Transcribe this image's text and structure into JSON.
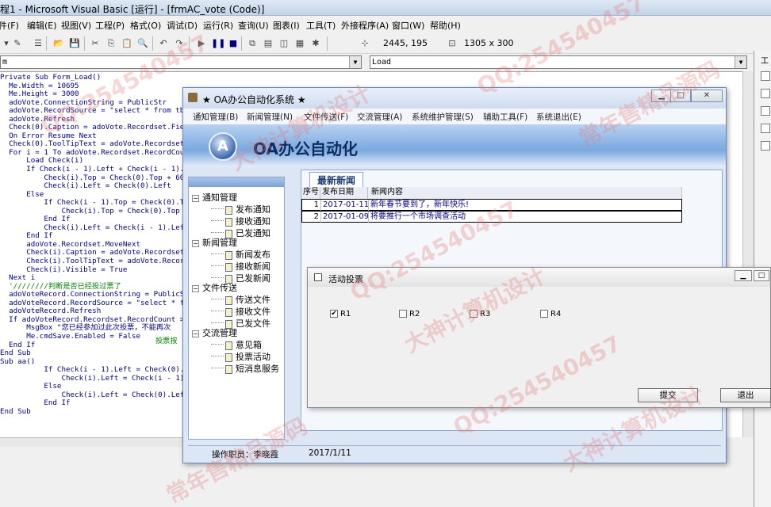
{
  "vb": {
    "title": "程1 - Microsoft Visual Basic [运行] - [frmAC_vote (Code)]",
    "menu": [
      "件(F)",
      "编辑(E)",
      "视图(V)",
      "工程(P)",
      "格式(O)",
      "调试(D)",
      "运行(R)",
      "查询(U)",
      "图表(I)",
      "工具(T)",
      "外接程序(A)",
      "窗口(W)",
      "帮助(H)"
    ],
    "toolbar": {
      "position": "2445, 195",
      "size": "1305 x 300"
    },
    "object_combo": "m",
    "proc_combo": "Load",
    "right_panel_label": "工",
    "code": [
      {
        "t": "Private Sub Form_Load()",
        "c": "k"
      },
      {
        "t": "  Me.Width = 10695",
        "c": "k"
      },
      {
        "t": "  Me.Height = 3000",
        "c": "k"
      },
      {
        "t": "  adoVote.ConnectionString = PublicStr",
        "c": "k"
      },
      {
        "t": "  adoVote.RecordSource = \"select * from tbO",
        "c": "k"
      },
      {
        "t": "  adoVote.Refresh",
        "c": "k"
      },
      {
        "t": "  Check(0).Caption = adoVote.Recordset.Fiel",
        "c": "k"
      },
      {
        "t": "  On Error Resume Next",
        "c": "k"
      },
      {
        "t": "  Check(0).ToolTipText = adoVote.Recordset.F",
        "c": "k"
      },
      {
        "t": "  For i = 1 To adoVote.Recordset.RecordCoun",
        "c": "k"
      },
      {
        "t": "      Load Check(i)",
        "c": "k"
      },
      {
        "t": "      If Check(i - 1).Left + Check(i - 1).W",
        "c": "k"
      },
      {
        "t": "          Check(i).Top = Check(0).Top + 600",
        "c": "k"
      },
      {
        "t": "          Check(i).Left = Check(0).Left",
        "c": "k"
      },
      {
        "t": "      Else",
        "c": "k"
      },
      {
        "t": "          If Check(i - 1).Top = Check(0).Top",
        "c": "k"
      },
      {
        "t": "              Check(i).Top = Check(0).Top + 60",
        "c": "k"
      },
      {
        "t": "          End If",
        "c": "k"
      },
      {
        "t": "          Check(i).Left = Check(i - 1).Left +",
        "c": "k"
      },
      {
        "t": "      End If",
        "c": "k"
      },
      {
        "t": "      adoVote.Recordset.MoveNext",
        "c": "k"
      },
      {
        "t": "      Check(i).Caption = adoVote.Recordset.",
        "c": "k"
      },
      {
        "t": "      Check(i).ToolTipText = adoVote.Record",
        "c": "k"
      },
      {
        "t": "      Check(i).Visible = True",
        "c": "k"
      },
      {
        "t": "  Next i",
        "c": "k"
      },
      {
        "t": "  '////////判断是否已经投过票了",
        "c": "g"
      },
      {
        "t": "  adoVoteRecord.ConnectionString = PublicSt",
        "c": "k"
      },
      {
        "t": "  adoVoteRecord.RecordSource = \"select * fr",
        "c": "k"
      },
      {
        "t": "  adoVoteRecord.Refresh",
        "c": "k"
      },
      {
        "t": "  If adoVoteRecord.Recordset.RecordCount > 0",
        "c": "k"
      },
      {
        "t": "      MsgBox \"您已经参加过此次投票，不能再次",
        "c": "k"
      },
      {
        "t": "      Me.cmdSave.Enabled = False",
        "c": "k"
      },
      {
        "t": "  End If",
        "c": "k"
      },
      {
        "t": "End Sub",
        "c": "k"
      },
      {
        "t": "Sub aa()",
        "c": "k"
      },
      {
        "t": "          If Check(i - 1).Left = Check(0).Le",
        "c": "k"
      },
      {
        "t": "              Check(i).Left = Check(i - 1).Le",
        "c": "k"
      },
      {
        "t": "          Else",
        "c": "k"
      },
      {
        "t": "              Check(i).Left = Check(0).Left",
        "c": "k"
      },
      {
        "t": "          End If",
        "c": "k"
      },
      {
        "t": "End Sub",
        "c": "k"
      }
    ],
    "code_tail_green": "投票按"
  },
  "oa": {
    "title": "★ OA办公自动化系统 ★",
    "menu": [
      "通知管理(B)",
      "新闻管理(N)",
      "文件传送(F)",
      "交流管理(A)",
      "系统维护管理(S)",
      "辅助工具(F)",
      "系统退出(E)"
    ],
    "logo_letter": "A",
    "brand": "OA办公自动化",
    "tree": [
      {
        "group": "通知管理",
        "items": [
          "发布通知",
          "接收通知",
          "已发通知"
        ]
      },
      {
        "group": "新闻管理",
        "items": [
          "新闻发布",
          "接收新闻",
          "已发新闻"
        ]
      },
      {
        "group": "文件传送",
        "items": [
          "传送文件",
          "接收文件",
          "已发文件"
        ]
      },
      {
        "group": "交流管理",
        "items": [
          "意见箱",
          "投票活动",
          "短消息服务"
        ]
      }
    ],
    "news": {
      "tab": "最新新闻",
      "columns": [
        "序号",
        "发布日期",
        "新闻内容"
      ],
      "rows": [
        {
          "no": "1",
          "date": "2017-01-11",
          "content": "新年春节要到了，新年快乐!"
        },
        {
          "no": "2",
          "date": "2017-01-09",
          "content": "将要推行一个市场调查活动"
        }
      ]
    },
    "status": {
      "operator": "操作职员：李晓霞",
      "date": "2017/1/11"
    }
  },
  "vote": {
    "title": "活动投票",
    "options": [
      {
        "label": "R1",
        "checked": true
      },
      {
        "label": "R2",
        "checked": false
      },
      {
        "label": "R3",
        "checked": false
      },
      {
        "label": "R4",
        "checked": false
      }
    ],
    "submit": "提交",
    "exit": "退出"
  },
  "watermarks": [
    "QQ:254540457",
    "大神计算机设计",
    "常年售精品源码"
  ]
}
